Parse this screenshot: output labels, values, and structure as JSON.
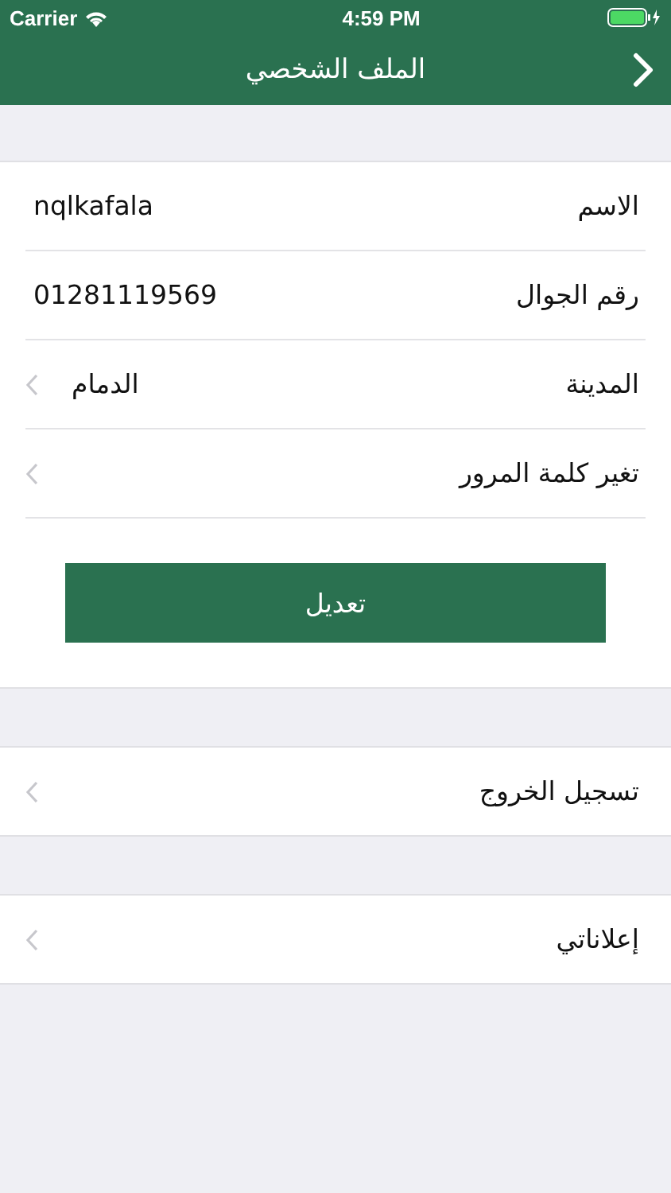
{
  "status_bar": {
    "carrier": "Carrier",
    "time": "4:59 PM"
  },
  "nav_bar": {
    "title": "الملف الشخصي"
  },
  "profile": {
    "rows": [
      {
        "kind": "info",
        "label": "الاسم",
        "value": "nqlkafala"
      },
      {
        "kind": "info",
        "label": "رقم الجوال",
        "value": "01281119569"
      },
      {
        "kind": "nav",
        "label": "المدينة",
        "value": "الدمام"
      },
      {
        "kind": "nav",
        "label": "تغير كلمة المرور"
      }
    ],
    "button": "تعديل"
  },
  "sections": [
    {
      "kind": "nav",
      "label": "تسجيل الخروج"
    },
    {
      "kind": "nav",
      "label": "إعلاناتي"
    }
  ]
}
